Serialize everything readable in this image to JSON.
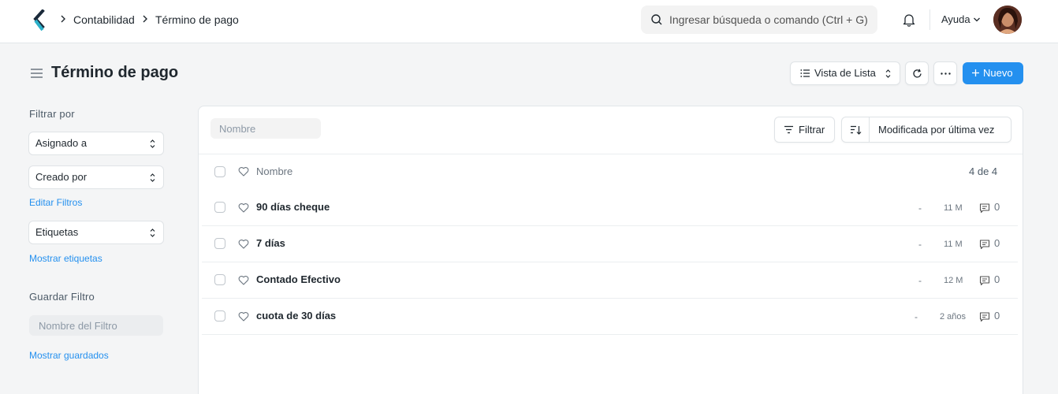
{
  "app": {
    "breadcrumbs": [
      "Contabilidad",
      "Término de pago"
    ],
    "search_placeholder": "Ingresar búsqueda o comando (Ctrl + G)",
    "help_label": "Ayuda",
    "accent_color": "#2490ef"
  },
  "header": {
    "title": "Término de pago",
    "view_label": "Vista de Lista",
    "new_label": "Nuevo"
  },
  "sidebar": {
    "filter_heading": "Filtrar por",
    "filters": [
      "Asignado a",
      "Creado por"
    ],
    "edit_filters_link": "Editar Filtros",
    "tags_select": "Etiquetas",
    "show_tags_link": "Mostrar etiquetas",
    "save_filter_heading": "Guardar Filtro",
    "filter_name_placeholder": "Nombre del Filtro",
    "show_saved_link": "Mostrar guardados"
  },
  "list": {
    "name_placeholder": "Nombre",
    "filter_label": "Filtrar",
    "sort_label": "Modificada por última vez",
    "column_name": "Nombre",
    "count_label": "4 de 4",
    "rows": [
      {
        "title": "90 días cheque",
        "dash": "-",
        "modified": "11 M",
        "comments": "0"
      },
      {
        "title": "7 días",
        "dash": "-",
        "modified": "11 M",
        "comments": "0"
      },
      {
        "title": "Contado Efectivo",
        "dash": "-",
        "modified": "12 M",
        "comments": "0"
      },
      {
        "title": "cuota de 30 días",
        "dash": "-",
        "modified": "2 años",
        "comments": "0"
      }
    ]
  }
}
